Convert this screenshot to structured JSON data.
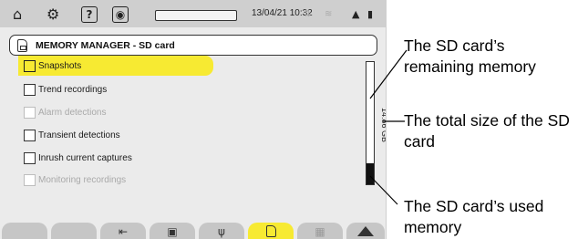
{
  "status_bar": {
    "icons": [
      "home-icon",
      "settings-icon",
      "help-icon",
      "camera-icon",
      "battery-icon",
      "sd-card-icon",
      "usb-icon",
      "network-icon"
    ],
    "help_glyph": "?",
    "datetime": "13/04/21 10:32"
  },
  "title": "MEMORY MANAGER - SD card",
  "items": [
    {
      "label": "Snapshots",
      "state": "selected"
    },
    {
      "label": "Trend recordings",
      "state": "enabled"
    },
    {
      "label": "Alarm detections",
      "state": "disabled"
    },
    {
      "label": "Transient detections",
      "state": "enabled"
    },
    {
      "label": "Inrush current captures",
      "state": "enabled"
    },
    {
      "label": "Monitoring recordings",
      "state": "disabled"
    }
  ],
  "memory": {
    "total_label": "14.86 GB",
    "used_fraction": 0.17
  },
  "softkeys": [
    {
      "icon": "blank"
    },
    {
      "icon": "blank"
    },
    {
      "icon": "export-icon"
    },
    {
      "icon": "chip-icon"
    },
    {
      "icon": "usb-icon"
    },
    {
      "icon": "sd-card-icon",
      "active": true
    },
    {
      "icon": "trash-icon",
      "disabled": true
    },
    {
      "icon": "eject-icon"
    }
  ],
  "callouts": {
    "remaining": "The SD card’s remaining memory",
    "total": "The total size of the SD card",
    "used": "The SD card’s used memory"
  },
  "colors": {
    "highlight": "#f7ea32",
    "screen_bg": "#ebebeb",
    "status_bar": "#cfcfcf"
  }
}
